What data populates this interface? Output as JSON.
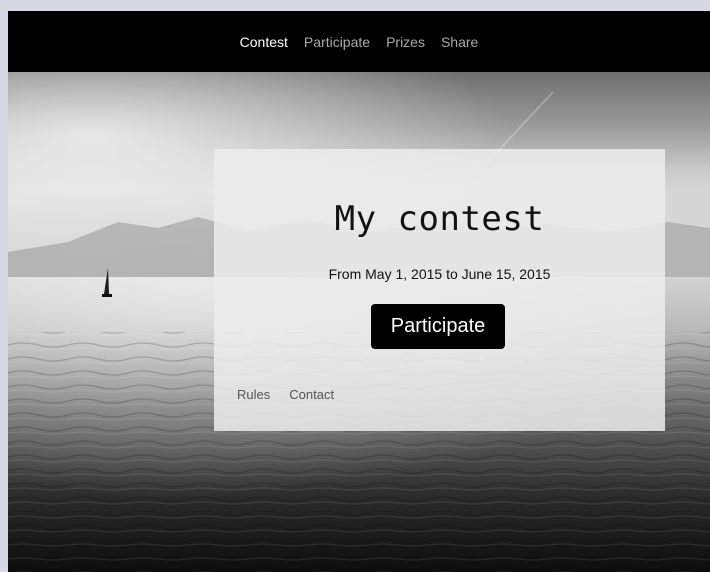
{
  "nav": {
    "items": [
      {
        "label": "Contest",
        "active": true
      },
      {
        "label": "Participate",
        "active": false
      },
      {
        "label": "Prizes",
        "active": false
      },
      {
        "label": "Share",
        "active": false
      }
    ]
  },
  "hero": {
    "image_description": "",
    "title": "My contest",
    "dates": "From May 1, 2015 to June 15, 2015",
    "cta_label": "Participate",
    "links": [
      {
        "label": "Rules"
      },
      {
        "label": "Contact"
      }
    ]
  },
  "colors": {
    "nav_bg": "#000000",
    "nav_active": "#ffffff",
    "nav_inactive": "#a9a9a9",
    "cta_bg": "#000000",
    "card_bg": "#ececec"
  }
}
